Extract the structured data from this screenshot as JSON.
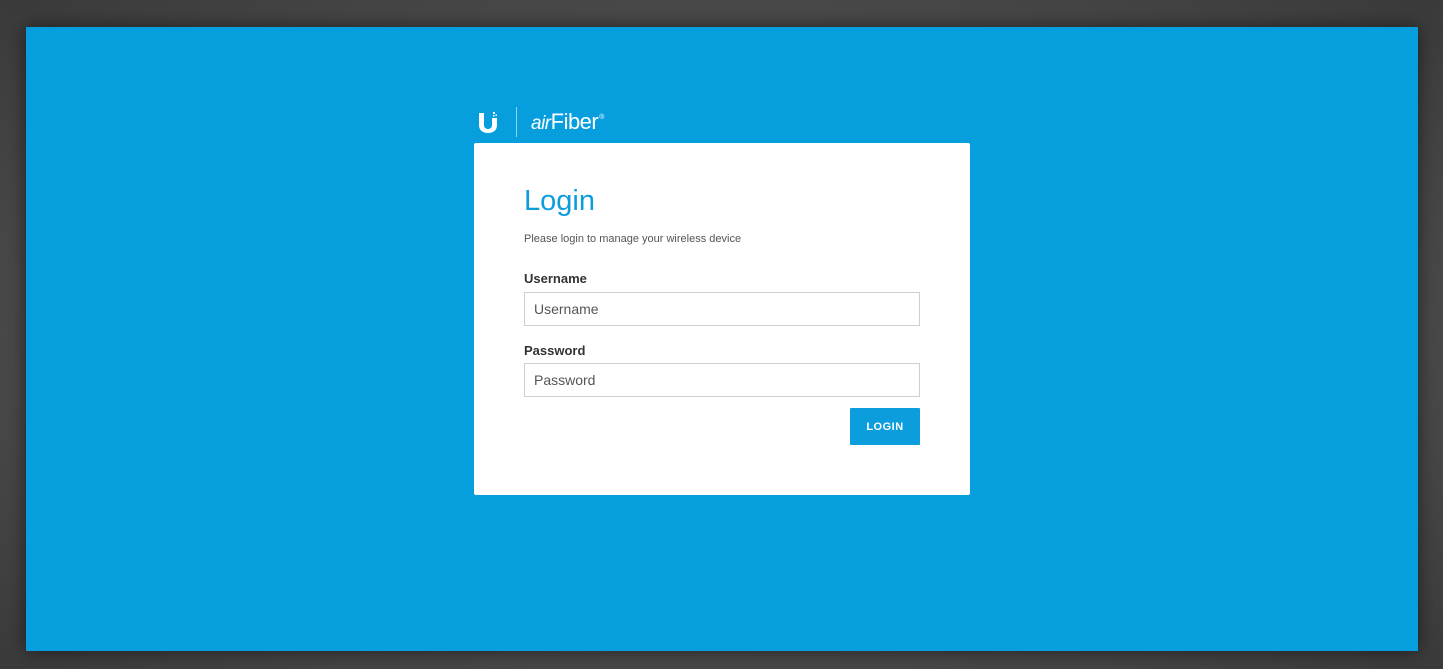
{
  "brand": {
    "product_prefix": "air",
    "product_suffix": "Fiber",
    "registered_mark": "®"
  },
  "login": {
    "title": "Login",
    "subtitle": "Please login to manage your wireless device",
    "username_label": "Username",
    "username_placeholder": "Username",
    "username_value": "",
    "password_label": "Password",
    "password_placeholder": "Password",
    "password_value": "",
    "submit_label": "LOGIN"
  },
  "colors": {
    "background": "#079ede",
    "accent": "#0c9ddd",
    "card": "#ffffff"
  },
  "icons": {
    "brand_logo": "ubiquiti-u-logo-icon"
  }
}
